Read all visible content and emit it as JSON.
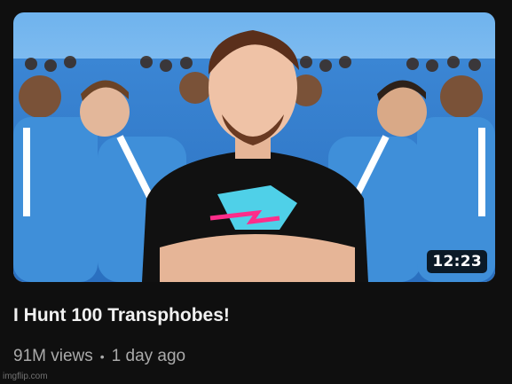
{
  "video": {
    "duration": "12:23",
    "title": "I Hunt 100 Transphobes!",
    "views": "91M views",
    "separator": "•",
    "age": "1 day ago"
  },
  "watermark": "imgflip.com",
  "colors": {
    "background": "#0f0f0f",
    "title": "#f1f1f1",
    "meta": "#aaaaaa",
    "tracksuit_blue": "#3f8fd9",
    "shirt": "#111111"
  }
}
